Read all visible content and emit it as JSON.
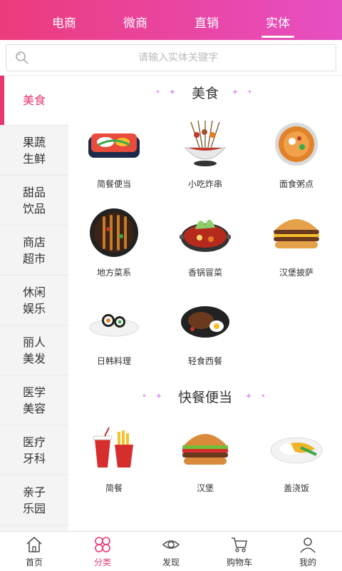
{
  "top_tabs": [
    {
      "label": "电商"
    },
    {
      "label": "微商"
    },
    {
      "label": "直销"
    },
    {
      "label": "实体"
    }
  ],
  "search": {
    "placeholder": "请输入实体关键字"
  },
  "sidebar": {
    "items": [
      {
        "label": "美食"
      },
      {
        "label": "果蔬生鲜"
      },
      {
        "label": "甜品饮品"
      },
      {
        "label": "商店超市"
      },
      {
        "label": "休闲娱乐"
      },
      {
        "label": "丽人美发"
      },
      {
        "label": "医学美容"
      },
      {
        "label": "医疗牙科"
      },
      {
        "label": "亲子乐园"
      }
    ]
  },
  "sections": [
    {
      "title": "美食",
      "items": [
        {
          "label": "简餐便当",
          "icon": "bento-box-icon"
        },
        {
          "label": "小吃炸串",
          "icon": "skewers-bowl-icon"
        },
        {
          "label": "面食粥点",
          "icon": "noodle-soup-icon"
        },
        {
          "label": "地方菜系",
          "icon": "bbq-skewers-plate-icon"
        },
        {
          "label": "香锅冒菜",
          "icon": "hot-pot-icon"
        },
        {
          "label": "汉堡披萨",
          "icon": "burger-icon"
        },
        {
          "label": "日韩料理",
          "icon": "sushi-plate-icon"
        },
        {
          "label": "轻食西餐",
          "icon": "steak-egg-plate-icon"
        }
      ]
    },
    {
      "title": "快餐便当",
      "items": [
        {
          "label": "简餐",
          "icon": "fries-cola-icon"
        },
        {
          "label": "汉堡",
          "icon": "burger-icon"
        },
        {
          "label": "盖浇饭",
          "icon": "rice-plate-icon"
        }
      ]
    }
  ],
  "bottom_nav": [
    {
      "label": "首页",
      "icon": "home-icon"
    },
    {
      "label": "分类",
      "icon": "category-icon"
    },
    {
      "label": "发现",
      "icon": "eye-icon"
    },
    {
      "label": "购物车",
      "icon": "cart-icon"
    },
    {
      "label": "我的",
      "icon": "user-icon"
    }
  ],
  "colors": {
    "accent": "#e6386f",
    "header_start": "#ec3b7c",
    "header_end": "#e64fc3"
  }
}
